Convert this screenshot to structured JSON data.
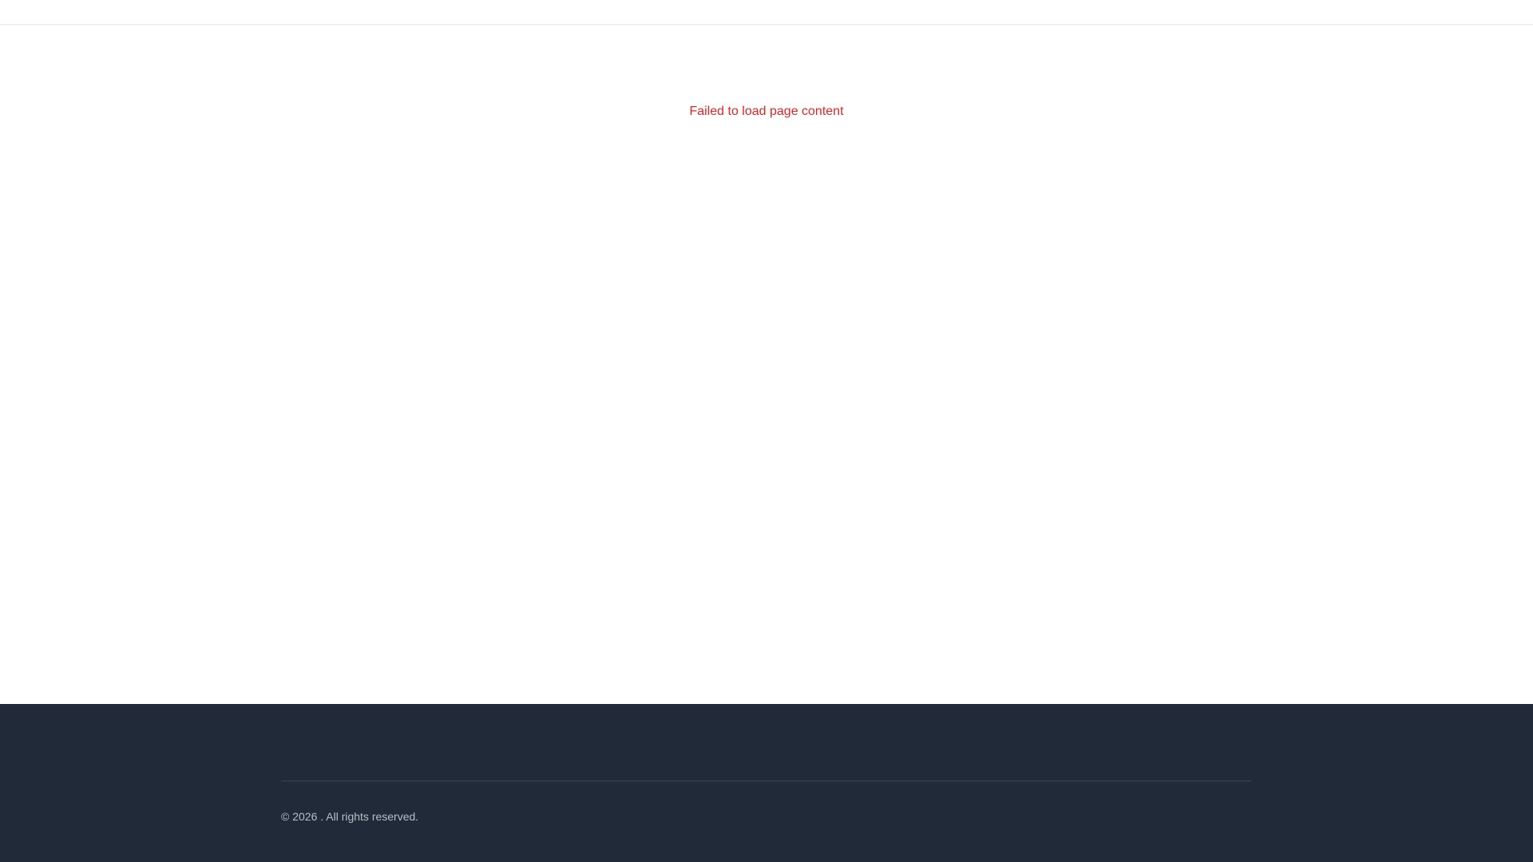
{
  "main": {
    "error_message": "Failed to load page content"
  },
  "footer": {
    "copyright": "© 2026 . All rights reserved."
  },
  "colors": {
    "error": "#dc2626",
    "footer_background": "#212a39",
    "footer_text": "#b8bec8"
  }
}
